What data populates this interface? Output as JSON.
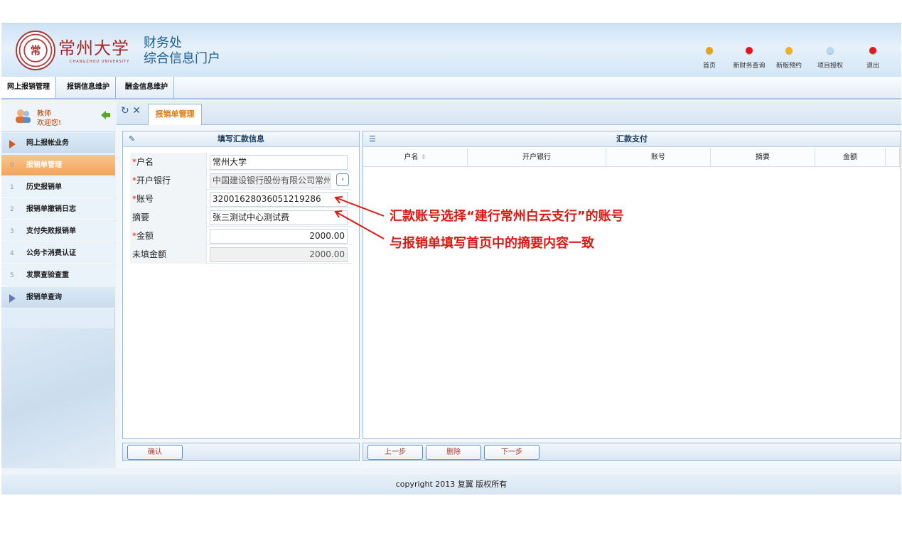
{
  "header": {
    "logo_name": "常州大学",
    "logo_en": "CHANGZHOU UNIVERSITY",
    "logo_seal": "常",
    "title_line1": "财务处",
    "title_line2": "综合信息门户",
    "nav": [
      {
        "label": "首页",
        "color": "#e8a317"
      },
      {
        "label": "新财务查询",
        "color": "#e8141c"
      },
      {
        "label": "新版预约",
        "color": "#f0b21c"
      },
      {
        "label": "项目授权",
        "color": "#b8d8f0"
      },
      {
        "label": "退出",
        "color": "#e8141c"
      }
    ]
  },
  "menubar": [
    "网上报销管理",
    "报销信息维护",
    "酬金信息维护"
  ],
  "sidebar": {
    "user_role": "教师",
    "welcome": "欢迎您!",
    "items": [
      {
        "num": "",
        "label": "网上报帐业务",
        "kind": "group"
      },
      {
        "num": "0",
        "label": "报销单管理",
        "kind": "selected"
      },
      {
        "num": "1",
        "label": "历史报销单",
        "kind": "plain"
      },
      {
        "num": "2",
        "label": "报销单撤销日志",
        "kind": "plain"
      },
      {
        "num": "3",
        "label": "支付失败报销单",
        "kind": "plain"
      },
      {
        "num": "4",
        "label": "公务卡消费认证",
        "kind": "plain"
      },
      {
        "num": "5",
        "label": "发票查验查重",
        "kind": "plain"
      },
      {
        "num": "",
        "label": "报销单查询",
        "kind": "group2"
      }
    ]
  },
  "tab": {
    "label": "报销单管理",
    "refresh_icon": "↻",
    "close_icon": "✕"
  },
  "left_panel": {
    "title": "填写汇款信息",
    "fields": [
      {
        "label": "户名",
        "required": true,
        "value": "常州大学"
      },
      {
        "label": "开户银行",
        "required": true,
        "value": "中国建设银行股份有限公司常州[",
        "picker": "›"
      },
      {
        "label": "账号",
        "required": true,
        "value": "32001628036051219286"
      },
      {
        "label": "摘要",
        "required": false,
        "value": "张三测试中心测试费"
      },
      {
        "label": "金额",
        "required": true,
        "value": "2000.00"
      },
      {
        "label": "未填金额",
        "required": false,
        "value": "2000.00"
      }
    ],
    "confirm_label": "确认"
  },
  "right_panel": {
    "title": "汇款支付",
    "columns": [
      "户名",
      "开户银行",
      "账号",
      "摘要",
      "金额"
    ],
    "sort_icon": "⇕",
    "buttons": [
      "上一步",
      "删除",
      "下一步"
    ]
  },
  "annotations": [
    "汇款账号选择“建行常州白云支行”的账号",
    "与报销单填写首页中的摘要内容一致"
  ],
  "footer": "copyright 2013 复翼 版权所有"
}
